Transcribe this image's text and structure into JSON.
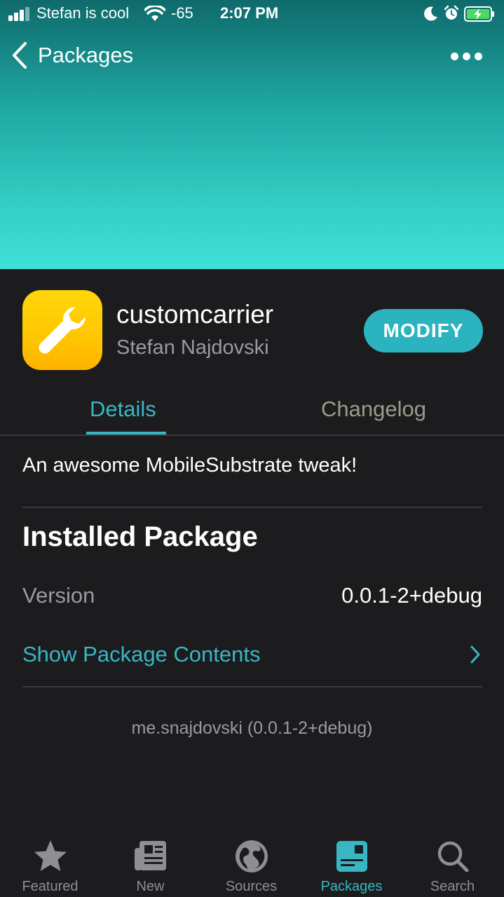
{
  "status_bar": {
    "carrier": "Stefan is cool",
    "signal_strength": "-65",
    "time": "2:07 PM",
    "icons": [
      "signal-bars-icon",
      "wifi-icon",
      "moon-icon",
      "alarm-icon",
      "battery-charging-icon"
    ]
  },
  "nav": {
    "back_label": "Packages",
    "back_icon": "chevron-left-icon",
    "more_icon": "ellipsis-icon"
  },
  "package": {
    "name": "customcarrier",
    "author": "Stefan Najdovski",
    "icon": "wrench-icon",
    "action_label": "MODIFY",
    "description": "An awesome MobileSubstrate tweak!",
    "identifier_line": "me.snajdovski (0.0.1-2+debug)"
  },
  "tabs": {
    "details": "Details",
    "changelog": "Changelog",
    "active": "details"
  },
  "installed": {
    "title": "Installed Package",
    "version_label": "Version",
    "version_value": "0.0.1-2+debug",
    "contents_label": "Show Package Contents"
  },
  "tabbar": {
    "items": [
      {
        "label": "Featured",
        "icon": "star-icon"
      },
      {
        "label": "New",
        "icon": "newspaper-icon"
      },
      {
        "label": "Sources",
        "icon": "globe-icon"
      },
      {
        "label": "Packages",
        "icon": "packages-icon"
      },
      {
        "label": "Search",
        "icon": "search-icon"
      }
    ],
    "active_index": 3
  },
  "colors": {
    "accent": "#38b6c4",
    "button": "#2bb3c0",
    "background": "#1c1c1e",
    "icon_yellow": "#ffc700"
  }
}
